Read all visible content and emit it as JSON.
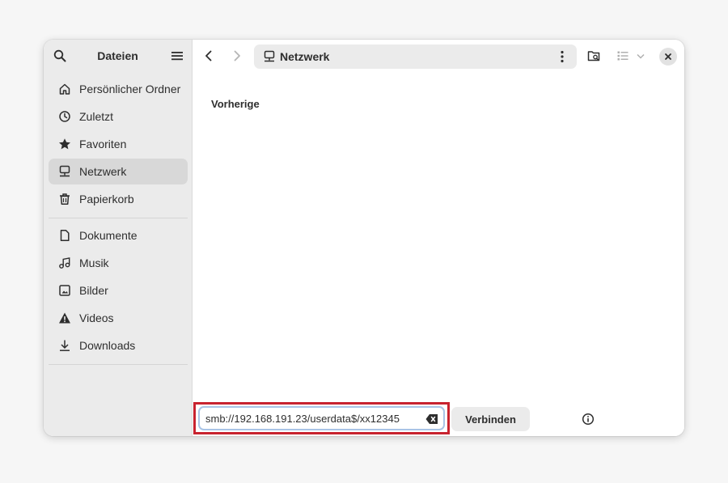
{
  "sidebar": {
    "title": "Dateien",
    "places": [
      {
        "label": "Persönlicher Ordner",
        "icon": "home-icon"
      },
      {
        "label": "Zuletzt",
        "icon": "clock-icon"
      },
      {
        "label": "Favoriten",
        "icon": "star-icon"
      },
      {
        "label": "Netzwerk",
        "icon": "network-icon",
        "active": true
      },
      {
        "label": "Papierkorb",
        "icon": "trash-icon"
      }
    ],
    "bookmarks": [
      {
        "label": "Dokumente",
        "icon": "document-icon"
      },
      {
        "label": "Musik",
        "icon": "music-icon"
      },
      {
        "label": "Bilder",
        "icon": "image-icon"
      },
      {
        "label": "Videos",
        "icon": "video-icon"
      },
      {
        "label": "Downloads",
        "icon": "download-icon"
      }
    ]
  },
  "pathbar": {
    "label": "Netzwerk",
    "icon": "network-icon"
  },
  "content": {
    "section_title": "Vorherige"
  },
  "connect_bar": {
    "url_value": "smb://192.168.191.23/userdata$/xx12345",
    "connect_label": "Verbinden"
  },
  "colors": {
    "accent_highlight": "#c8232f",
    "sidebar_bg": "#ebebeb",
    "active_item_bg": "#d8d8d8"
  }
}
